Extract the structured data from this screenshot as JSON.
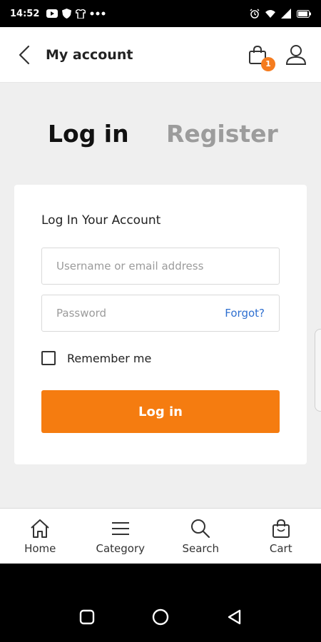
{
  "status_bar": {
    "time": "14:52",
    "left_icons": [
      "youtube-icon",
      "shield-icon",
      "tshirt-icon",
      "more-dots-icon"
    ],
    "right_icons": [
      "alarm-icon",
      "wifi-icon",
      "signal-icon",
      "battery-icon"
    ]
  },
  "header": {
    "title": "My account",
    "cart_count": "1",
    "icons": [
      "back-arrow-icon",
      "shopping-bag-icon",
      "user-icon"
    ]
  },
  "tabs": {
    "login": "Log in",
    "register": "Register",
    "active": "login"
  },
  "form": {
    "title": "Log In Your Account",
    "username_placeholder": "Username or email address",
    "password_placeholder": "Password",
    "forgot_label": "Forgot?",
    "remember_label": "Remember me",
    "remember_checked": false,
    "submit_label": "Log in"
  },
  "bottom_nav": {
    "items": [
      {
        "label": "Home",
        "icon": "home-icon"
      },
      {
        "label": "Category",
        "icon": "menu-icon"
      },
      {
        "label": "Search",
        "icon": "search-icon"
      },
      {
        "label": "Cart",
        "icon": "bag-icon"
      }
    ]
  },
  "system_nav": [
    "recent-apps-icon",
    "home-circle-icon",
    "back-triangle-icon"
  ],
  "colors": {
    "accent": "#f57c10",
    "link": "#2e6fd0",
    "background": "#efefef",
    "inactive_tab": "#9c9c9c"
  }
}
